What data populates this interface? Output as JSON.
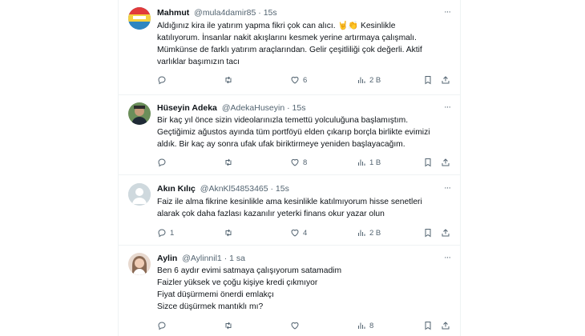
{
  "tweets": [
    {
      "name": "Mahmut",
      "handle": "@mula4damir85",
      "time": "· 15s",
      "lines": [
        "Aldığınız kira ile yatırım yapma fikri çok can alıcı. 🤘👏 Kesinlikle",
        "katılıyorum. İnsanlar nakit akışlarını kesmek yerine artırmaya çalışmalı.",
        "Mümkünse de  farklı yatırım araçlarından. Gelir çeşitliliği çok değerli. Aktif",
        "varlıklar başımızın tacı"
      ],
      "replies": "",
      "retweets": "",
      "likes": "6",
      "views": "2 B"
    },
    {
      "name": "Hüseyin Adeka",
      "handle": "@AdekaHuseyin",
      "time": "· 15s",
      "lines": [
        "Bir kaç yıl önce sizin videolarınızla temettü yolculuğuna başlamıştım.",
        "Geçtiğimiz ağustos ayında tüm portföyü elden çıkarıp borçla birlikte evimizi",
        "aldık. Bir kaç ay sonra ufak ufak biriktirmeye yeniden başlayacağım."
      ],
      "replies": "",
      "retweets": "",
      "likes": "8",
      "views": "1 B"
    },
    {
      "name": "Akın Kılıç",
      "handle": "@AknKl54853465",
      "time": "· 15s",
      "lines": [
        "Faiz ile alma fikrine kesinlikle ama kesinlikle katılmıyorum hisse senetleri",
        "alarak çok daha fazlası kazanılır yeterki finans okur yazar olun"
      ],
      "replies": "1",
      "retweets": "",
      "likes": "4",
      "views": "2 B"
    },
    {
      "name": "Aylin",
      "handle": "@Aylinnil1",
      "time": "· 1 sa",
      "lines": [
        "Ben 6 aydır evimi satmaya çalışıyorum satamadim",
        "Faizler yüksek ve çoğu kişiye kredi çıkmıyor",
        "Fiyat düşürmemi önerdi emlakçı",
        "Sizce düşürmek mantıklı mı?"
      ],
      "replies": "",
      "retweets": "",
      "likes": "",
      "views": "8"
    }
  ],
  "more_glyph": "···",
  "colors": {
    "text": "#0f1419",
    "muted": "#536471",
    "border": "#eff3f4"
  }
}
